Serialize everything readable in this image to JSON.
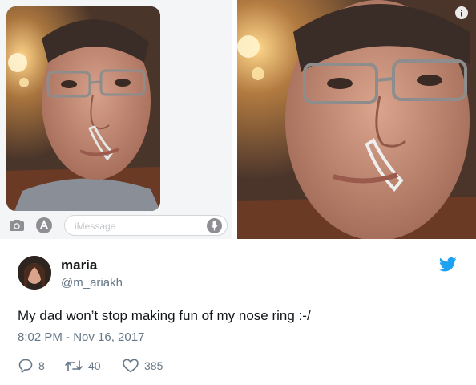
{
  "imessage": {
    "placeholder": "iMessage",
    "icons": [
      "camera-icon",
      "app-store-icon",
      "microphone-icon"
    ]
  },
  "photo_overlay": {
    "icon": "info-icon"
  },
  "tweet": {
    "display_name": "maria",
    "handle": "@m_ariakh",
    "text": "My dad won’t stop making fun of my nose ring :-/",
    "timestamp": "8:02 PM - Nov 16, 2017",
    "actions": {
      "replies": "8",
      "retweets": "40",
      "likes": "385"
    },
    "brand_color": "#1da1f2",
    "text_color": "#14171a",
    "muted_color": "#657786"
  }
}
